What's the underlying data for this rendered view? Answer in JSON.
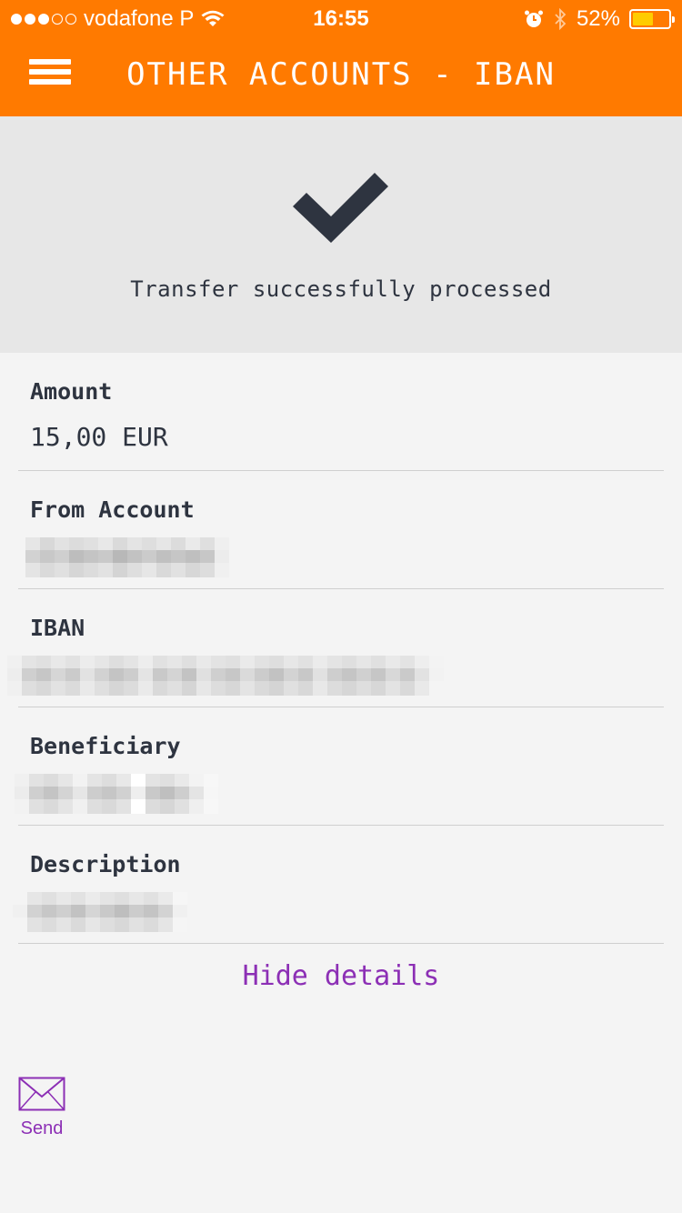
{
  "status_bar": {
    "carrier": "vodafone P",
    "time": "16:55",
    "battery": "52%",
    "signal_bars_filled": 3,
    "signal_bars_total": 5
  },
  "header": {
    "title": "OTHER ACCOUNTS - IBAN"
  },
  "result": {
    "message": "Transfer successfully processed"
  },
  "details": {
    "amount_label": "Amount",
    "amount_value": "15,00 EUR",
    "from_account_label": "From Account",
    "iban_label": "IBAN",
    "beneficiary_label": "Beneficiary",
    "description_label": "Description"
  },
  "actions": {
    "hide_details": "Hide details",
    "send": "Send"
  },
  "colors": {
    "brand_orange": "#ff7a00",
    "link_purple": "#8c2fb5",
    "text_dark": "#2e3440",
    "battery_fill": "#ffcc00"
  }
}
